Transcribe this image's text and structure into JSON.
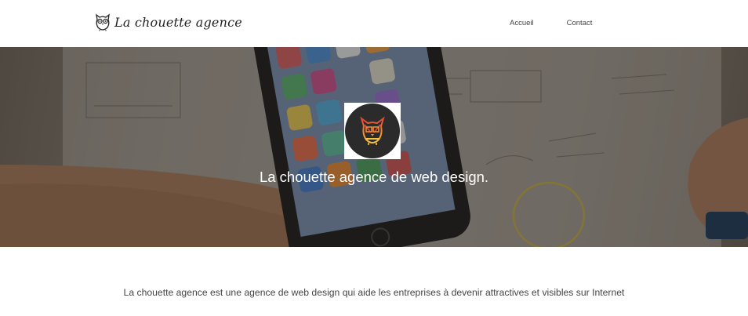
{
  "header": {
    "brand_name": "La chouette agence",
    "brand_icon": "owl-icon",
    "nav": [
      {
        "label": "Accueil"
      },
      {
        "label": "Contact"
      }
    ]
  },
  "hero": {
    "logo_icon": "owl-logo-icon",
    "title": "La chouette agence de web design."
  },
  "intro": {
    "text": "La chouette agence est une agence de web design qui aide les entreprises à devenir attractives et visibles sur Internet"
  },
  "colors": {
    "logo_background": "#2b2b2b",
    "logo_accent_red": "#e0443a",
    "logo_accent_orange": "#f08a2c",
    "logo_accent_yellow": "#f5c242",
    "hero_text": "#ffffff"
  }
}
